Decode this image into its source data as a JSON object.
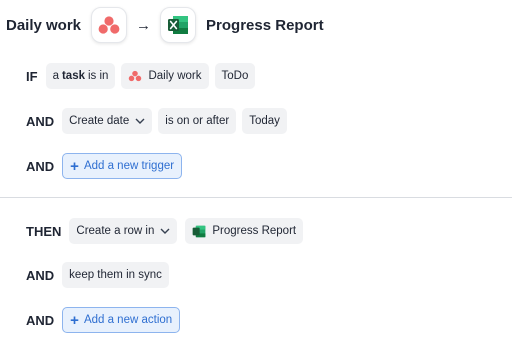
{
  "header": {
    "source_app": "Daily work",
    "target_app": "Progress Report",
    "arrow": "→",
    "source_icon": "asana-icon",
    "target_icon": "excel-icon"
  },
  "trigger": {
    "if_label": "IF",
    "task_prefix": "a",
    "task_bold": "task",
    "task_suffix": "is in",
    "project": "Daily work",
    "section": "ToDo"
  },
  "condition": {
    "and_label": "AND",
    "field": "Create date",
    "operator": "is on or after",
    "value": "Today"
  },
  "add_trigger": {
    "and_label": "AND",
    "plus": "+",
    "label": "Add a new trigger"
  },
  "action": {
    "then_label": "THEN",
    "verb": "Create a row in",
    "target": "Progress Report"
  },
  "sync": {
    "and_label": "AND",
    "label": "keep them in sync"
  },
  "add_action": {
    "and_label": "AND",
    "plus": "+",
    "label": "Add a new action"
  },
  "colors": {
    "asana": "#f06a6a",
    "excel": "#1e7145",
    "link": "#2f6fd1",
    "link_bg": "#e8f1fd"
  }
}
